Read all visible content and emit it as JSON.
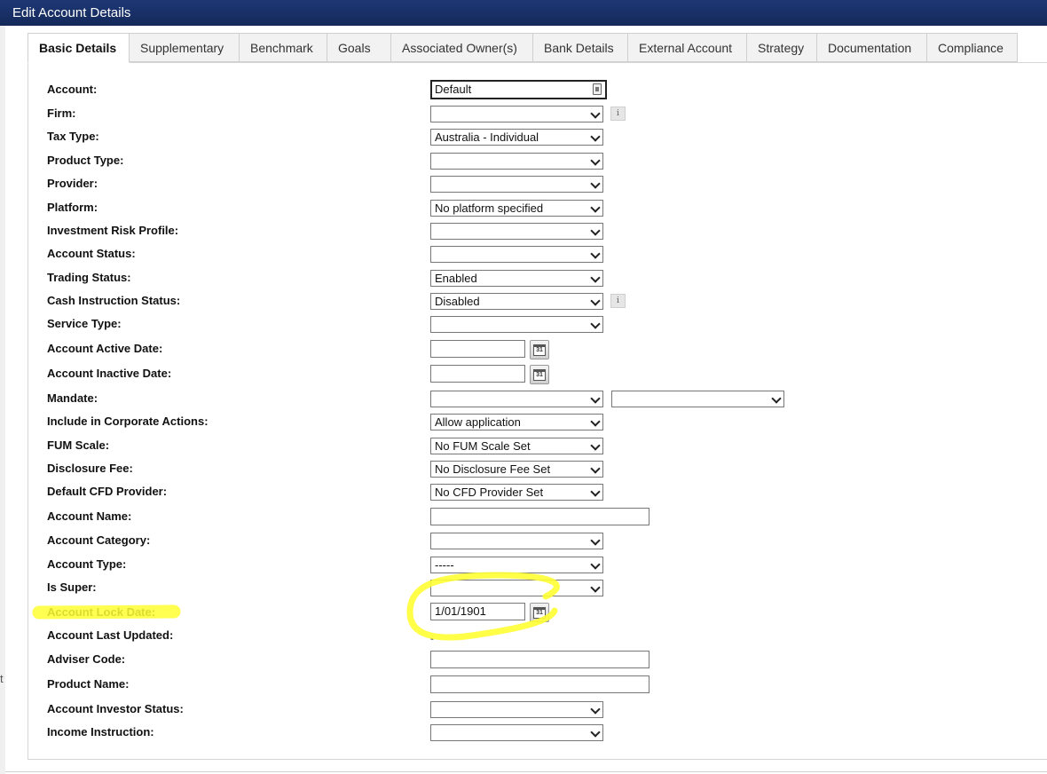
{
  "window": {
    "title": "Edit Account Details"
  },
  "stray_char": "t",
  "tabs": [
    {
      "label": "Basic Details",
      "active": true
    },
    {
      "label": "Supplementary"
    },
    {
      "label": "Benchmark"
    },
    {
      "label": "Goals"
    },
    {
      "label": "Associated Owner(s)"
    },
    {
      "label": "Bank Details"
    },
    {
      "label": "External Account"
    },
    {
      "label": "Strategy"
    },
    {
      "label": "Documentation"
    },
    {
      "label": "Compliance"
    }
  ],
  "fields": {
    "account": {
      "label": "Account:",
      "value": "Default"
    },
    "firm": {
      "label": "Firm:",
      "value": ""
    },
    "tax_type": {
      "label": "Tax Type:",
      "value": "Australia - Individual"
    },
    "product_type": {
      "label": "Product Type:",
      "value": ""
    },
    "provider": {
      "label": "Provider:",
      "value": ""
    },
    "platform": {
      "label": "Platform:",
      "value": "No platform specified"
    },
    "investment_risk_profile": {
      "label": "Investment Risk Profile:",
      "value": ""
    },
    "account_status": {
      "label": "Account Status:",
      "value": ""
    },
    "trading_status": {
      "label": "Trading Status:",
      "value": "Enabled"
    },
    "cash_instruction_status": {
      "label": "Cash Instruction Status:",
      "value": "Disabled"
    },
    "service_type": {
      "label": "Service Type:",
      "value": ""
    },
    "account_active_date": {
      "label": "Account Active Date:",
      "value": ""
    },
    "account_inactive_date": {
      "label": "Account Inactive Date:",
      "value": ""
    },
    "mandate": {
      "label": "Mandate:",
      "value": "",
      "value2": ""
    },
    "include_corporate_actions": {
      "label": "Include in Corporate Actions:",
      "value": "Allow application"
    },
    "fum_scale": {
      "label": "FUM Scale:",
      "value": "No FUM Scale Set"
    },
    "disclosure_fee": {
      "label": "Disclosure Fee:",
      "value": "No Disclosure Fee Set"
    },
    "default_cfd_provider": {
      "label": "Default CFD Provider:",
      "value": "No CFD Provider Set"
    },
    "account_name": {
      "label": "Account Name:",
      "value": ""
    },
    "account_category": {
      "label": "Account Category:",
      "value": ""
    },
    "account_type": {
      "label": "Account Type:",
      "value": "-----"
    },
    "is_super": {
      "label": "Is Super:",
      "value": ""
    },
    "account_lock_date": {
      "label": "Account Lock Date:",
      "value": "1/01/1901"
    },
    "account_last_updated": {
      "label": "Account Last Updated:",
      "value": "-"
    },
    "adviser_code": {
      "label": "Adviser Code:",
      "value": ""
    },
    "product_name": {
      "label": "Product Name:",
      "value": ""
    },
    "account_investor_status": {
      "label": "Account Investor Status:",
      "value": ""
    },
    "income_instruction": {
      "label": "Income Instruction:",
      "value": ""
    }
  },
  "icons": {
    "calendar_day": "31",
    "info_glyph": "i",
    "calendar": "calendar-icon",
    "info": "info-icon",
    "lookup": "lookup-icon",
    "dropdown": "chevron-down-icon"
  },
  "colors": {
    "title_bar": "#1e3875",
    "highlight": "#ffff33"
  }
}
